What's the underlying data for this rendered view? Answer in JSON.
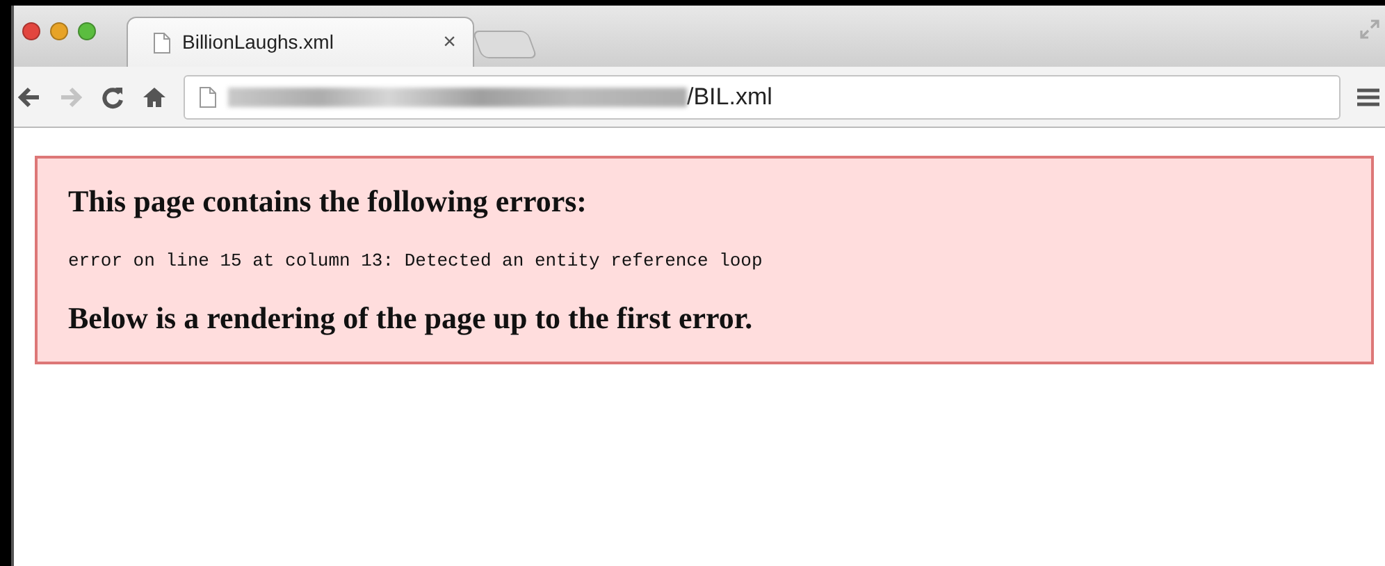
{
  "tabs": [
    {
      "title": "BillionLaughs.xml",
      "close": "×",
      "selected": true
    }
  ],
  "toolbar": [
    {
      "kind": "back",
      "disabled": false
    },
    {
      "kind": "forward",
      "disabled": true
    },
    {
      "kind": "reload",
      "disabled": false
    },
    {
      "kind": "home",
      "disabled": false
    }
  ],
  "address_bar": {
    "url": "/BIL.xml"
  },
  "error_box": {
    "heading": "This page contains the following errors:",
    "message": "error on line 15 at column 13: Detected an entity reference loop",
    "footer": "Below is a rendering of the page up to the first error."
  }
}
